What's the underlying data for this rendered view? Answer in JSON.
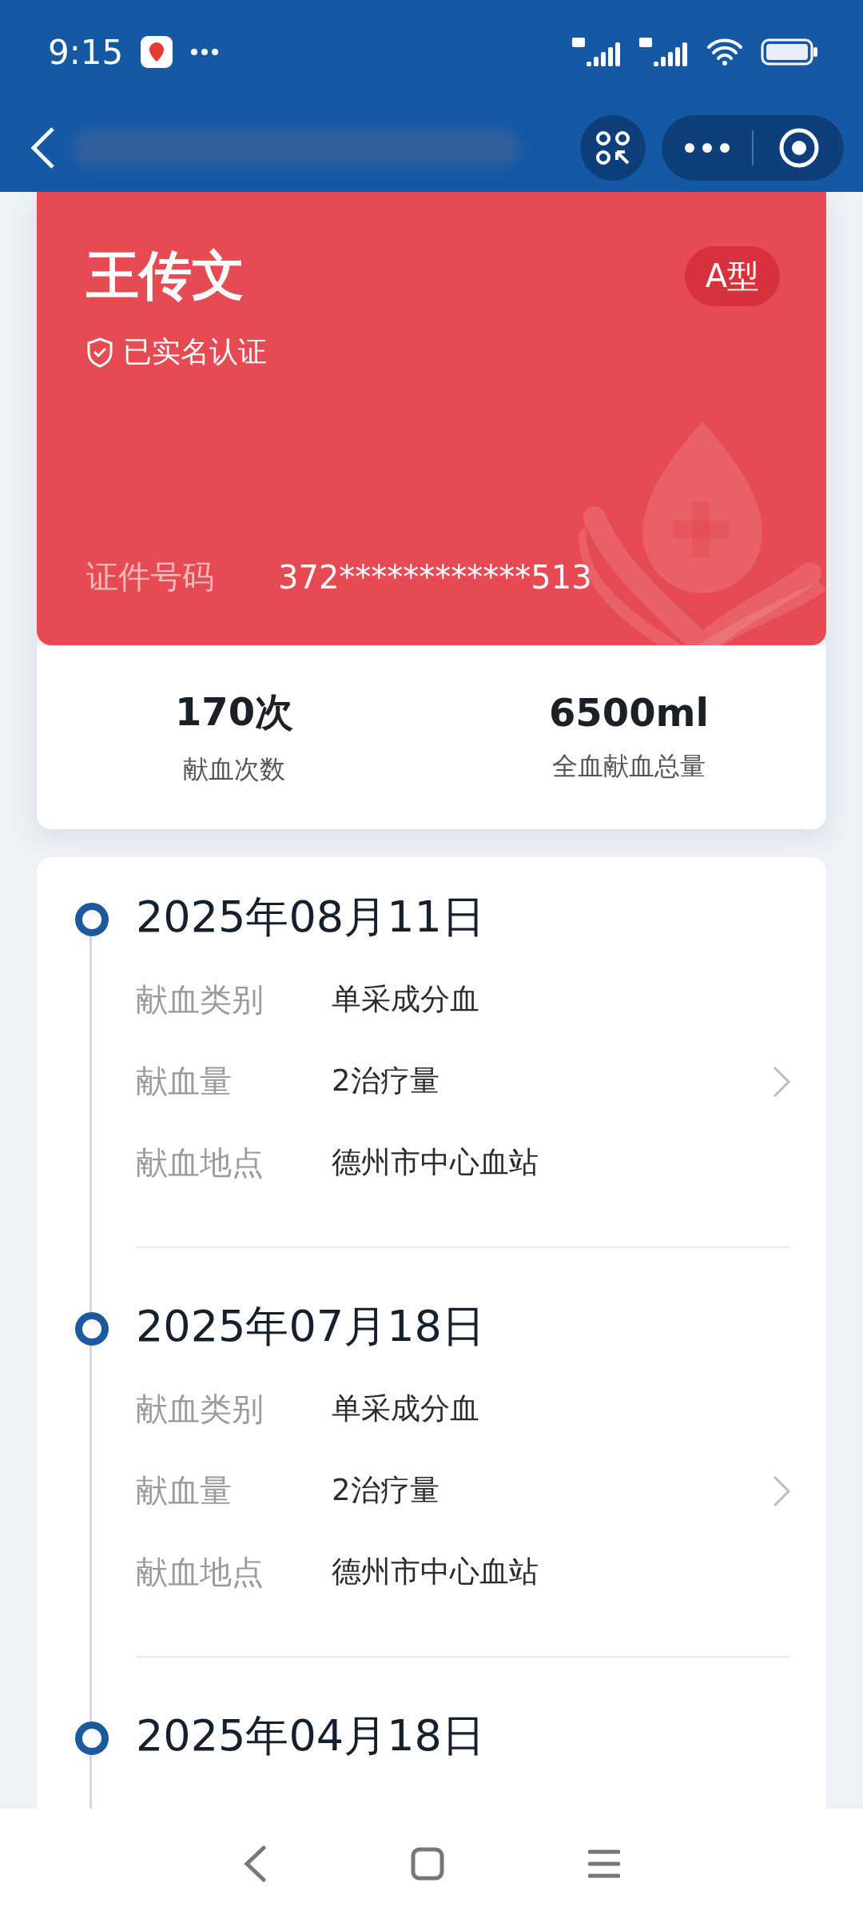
{
  "status_bar": {
    "time": "9:15"
  },
  "donor_card": {
    "name": "王传文",
    "verified": "已实名认证",
    "blood_type": "A型",
    "id_label": "证件号码",
    "id_number": "372************513"
  },
  "stats": [
    {
      "value": "170次",
      "label": "献血次数"
    },
    {
      "value": "6500ml",
      "label": "全血献血总量"
    }
  ],
  "records": [
    {
      "date": "2025年08月11日",
      "fields": [
        {
          "label": "献血类别",
          "value": "单采成分血"
        },
        {
          "label": "献血量",
          "value": "2治疗量"
        },
        {
          "label": "献血地点",
          "value": "德州市中心血站"
        }
      ]
    },
    {
      "date": "2025年07月18日",
      "fields": [
        {
          "label": "献血类别",
          "value": "单采成分血"
        },
        {
          "label": "献血量",
          "value": "2治疗量"
        },
        {
          "label": "献血地点",
          "value": "德州市中心血站"
        }
      ]
    },
    {
      "date": "2025年04月18日"
    }
  ]
}
